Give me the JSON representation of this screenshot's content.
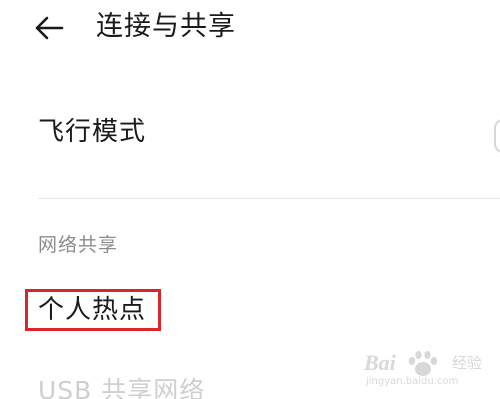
{
  "header": {
    "back_icon": "arrow-left-icon",
    "title": "连接与共享"
  },
  "items": {
    "airplane_mode": {
      "label": "飞行模式",
      "toggle_on": false
    },
    "section_network_sharing": {
      "header": "网络共享"
    },
    "personal_hotspot": {
      "label": "个人热点",
      "highlighted": true,
      "highlight_color": "#d9262b"
    },
    "usb_tethering": {
      "label": "USB 共享网络"
    }
  },
  "watermark": {
    "brand": "Bai",
    "icon": "baidu-paw-icon",
    "product": "经验",
    "url": "jingyan.baidu.com"
  },
  "colors": {
    "background": "#ffffff",
    "text_primary": "#1a1a1a",
    "text_secondary": "#8c8c8c",
    "divider": "#e6e6e6"
  }
}
